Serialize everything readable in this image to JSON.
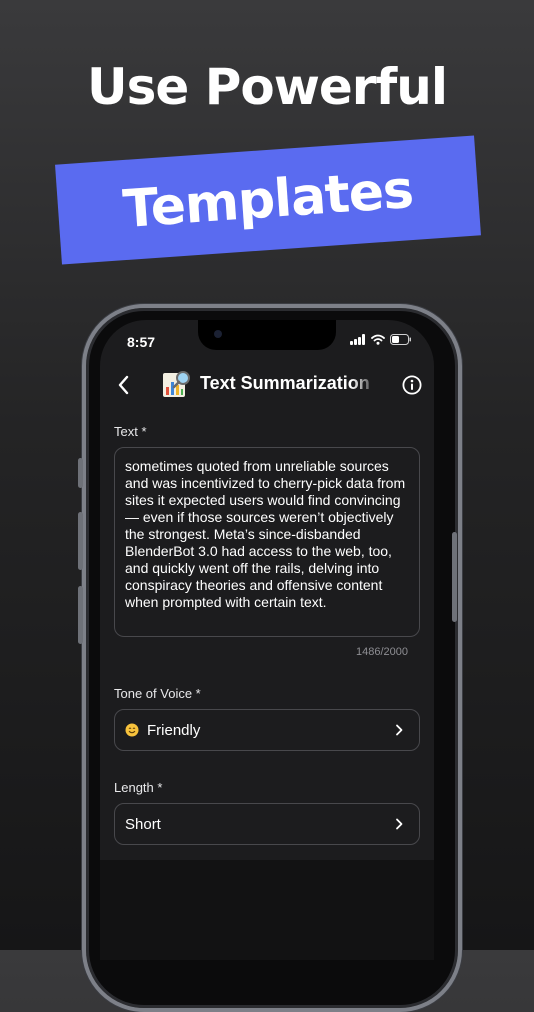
{
  "promo": {
    "headline": "Use Powerful",
    "banner": "Templates",
    "banner_color": "#5a6bf0"
  },
  "status_bar": {
    "time": "8:57",
    "icons": [
      "signal-icon",
      "wifi-icon",
      "battery-icon"
    ]
  },
  "nav": {
    "back_icon": "chevron-left-icon",
    "app_icon": "chart-magnifier-icon",
    "title": "Text Summarization",
    "info_icon": "info-icon"
  },
  "form": {
    "text_label": "Text *",
    "text_value": "sometimes quoted from unreliable sources and was incentivized to cherry-pick data from sites it expected users would find convincing — even if those sources weren’t objectively the strongest. Meta’s since-disbanded BlenderBot 3.0 had access to the web, too, and quickly went off the rails, delving into conspiracy theories and offensive content when prompted with certain text.",
    "counter": "1486/2000",
    "tone_label": "Tone of Voice *",
    "tone_emoji": "smiling-face-emoji",
    "tone_value": "Friendly",
    "length_label": "Length *",
    "length_value": "Short"
  },
  "colors": {
    "screen_bg": "#1c1c1e",
    "border": "#48484c",
    "accent": "#5a6bf0"
  }
}
